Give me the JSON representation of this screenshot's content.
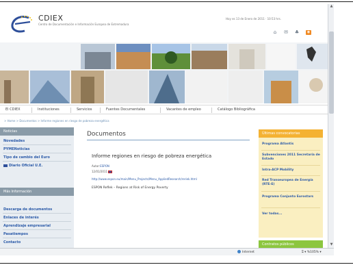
{
  "header": {
    "brand_name": "CDIEX",
    "brand_subtitle": "Centro de Documentación e Información Europea de Extremadura",
    "date_line": "Hoy es 13 de Enero de 2011 · 10:53 hrs."
  },
  "header_icons": [
    "home-icon",
    "mail-icon",
    "sitemap-icon",
    "rss-icon"
  ],
  "nav": {
    "items": [
      "El CDIEX",
      "Instituciones",
      "Servicios",
      "Fuentes Documentales",
      "Vacantes de empleo",
      "Catálogo Bibliográfica"
    ]
  },
  "breadcrumb": "> Home > Documentos > Informe regiones en riesgo de pobreza energética",
  "sidebar": {
    "heading_1": "Noticias",
    "items_1": [
      "Novedades",
      "PYMENoticias",
      "Tipo de cambio del Euro",
      "Diario Oficial U.E."
    ],
    "heading_2": "Más Información",
    "items_2": [
      "Descarga de documentos",
      "Enlaces de interés",
      "Aprendizaje empresarial",
      "Pasatiempos",
      "Contacto"
    ]
  },
  "main": {
    "page_title": "Documentos",
    "doc_title": "Informe regiones en riesgo de pobreza energética",
    "author_label": "Autor:",
    "author": "ESPON",
    "date": "12/01/2011",
    "link": "http://www.espon.eu/main/Menu_Projects/Menu_AppliedResearch/reriek.html",
    "description": "ESPON Reflek – Regions at Risk of Energy Poverty"
  },
  "rightcol": {
    "heading": "Últimas convocatorias",
    "items": [
      "Programa Atlantis",
      "Subvenciones 2011 Secretaría de Estado",
      "Intra-ACP Mobility",
      "Red Transeuropea de Energía (RTE-E)",
      "Programa Conjunto Eurostars",
      "Ver todas..."
    ],
    "green_heading": "Contratos públicos"
  },
  "statusbar": {
    "zone": "Internet",
    "zoom": "⍂ ▾ %105% ▾"
  },
  "colors": {
    "accent_orange": "#f4b233",
    "sidebar_head": "#8a9ba8",
    "link_blue": "#2b5aa8",
    "green": "#8cc63f"
  }
}
